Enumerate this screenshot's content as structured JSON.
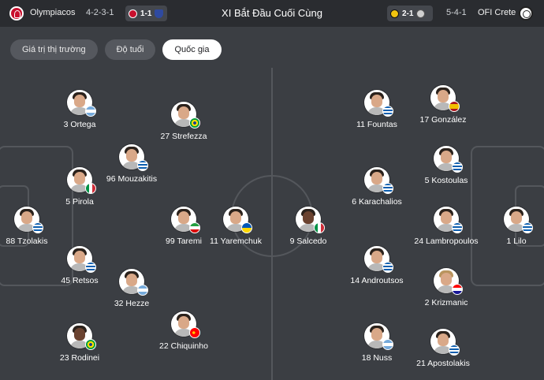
{
  "header": {
    "home_team": "Olympiacos",
    "home_formation": "4-2-3-1",
    "home_last_score": "1-1",
    "title": "XI Bắt Đầu Cuối Cùng",
    "away_last_score": "2-1",
    "away_formation": "5-4-1",
    "away_team": "OFI Crete"
  },
  "tabs": [
    {
      "label": "Giá trị thị trường",
      "active": false
    },
    {
      "label": "Độ tuổi",
      "active": false
    },
    {
      "label": "Quốc gia",
      "active": true
    }
  ],
  "home_players": [
    {
      "name": "3 Ortega",
      "flag": "ar"
    },
    {
      "name": "27 Strefezza",
      "flag": "br"
    },
    {
      "name": "96 Mouzakitis",
      "flag": "gr"
    },
    {
      "name": "5 Pirola",
      "flag": "it"
    },
    {
      "name": "88 Tzolakis",
      "flag": "gr"
    },
    {
      "name": "99 Taremi",
      "flag": "ir"
    },
    {
      "name": "11 Yaremchuk",
      "flag": "ua"
    },
    {
      "name": "45 Retsos",
      "flag": "gr"
    },
    {
      "name": "32 Hezze",
      "flag": "ar"
    },
    {
      "name": "22 Chiquinho",
      "flag": "pt"
    },
    {
      "name": "23 Rodinei",
      "flag": "br"
    }
  ],
  "away_players": [
    {
      "name": "9 Salcedo",
      "flag": "it"
    },
    {
      "name": "11 Fountas",
      "flag": "gr"
    },
    {
      "name": "17 González",
      "flag": "es"
    },
    {
      "name": "5 Kostoulas",
      "flag": "gr"
    },
    {
      "name": "6 Karachalios",
      "flag": "gr"
    },
    {
      "name": "24 Lambropoulos",
      "flag": "gr"
    },
    {
      "name": "1 Lilo",
      "flag": "gr"
    },
    {
      "name": "14 Androutsos",
      "flag": "gr"
    },
    {
      "name": "2 Krizmanic",
      "flag": "hr"
    },
    {
      "name": "18 Nuss",
      "flag": "ar"
    },
    {
      "name": "21 Apostolakis",
      "flag": "gr"
    }
  ],
  "colors": {
    "background": "#3b3e43",
    "header_bg": "#2a2c30",
    "pitch_lines": "#54575c",
    "tab_active_bg": "#ffffff"
  }
}
